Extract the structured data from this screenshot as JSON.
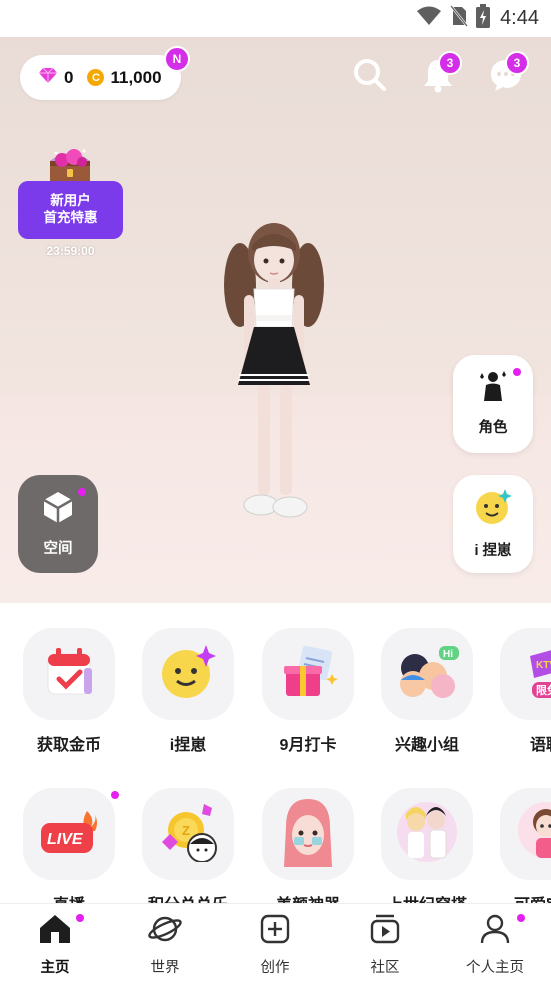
{
  "status_bar": {
    "time": "4:44",
    "icons": [
      "wifi-icon",
      "no-sim-icon",
      "battery-charging-icon"
    ]
  },
  "header": {
    "gems": "0",
    "coins": "11,000",
    "new_badge": "N",
    "notifications_count": "3",
    "messages_count": "3",
    "icons": [
      "gem-icon",
      "coin-icon",
      "search-icon",
      "bell-icon",
      "chat-icon"
    ]
  },
  "promo": {
    "line1": "新用户",
    "line2": "首充特惠",
    "timer": "23:59:00"
  },
  "side_actions": {
    "character_label": "角色",
    "face_edit_label": "i 捏崽",
    "space_label": "空间"
  },
  "feature_rows": [
    [
      {
        "label": "获取金币",
        "icon": "calendar-check-icon"
      },
      {
        "label": "i捏崽",
        "icon": "smile-face-icon"
      },
      {
        "label": "9月打卡",
        "icon": "gift-checklist-icon"
      },
      {
        "label": "兴趣小组",
        "icon": "group-hi-icon"
      },
      {
        "label": "语聊",
        "icon": "ktv-icon",
        "tag": "限免"
      }
    ],
    [
      {
        "label": "直播",
        "icon": "live-icon"
      },
      {
        "label": "积分总总乐",
        "icon": "points-coin-icon"
      },
      {
        "label": "美颜神器",
        "icon": "beauty-face-icon"
      },
      {
        "label": "上世纪穿搭",
        "icon": "retro-outfit-icon"
      },
      {
        "label": "可爱宝宝",
        "icon": "cute-baby-icon"
      }
    ]
  ],
  "bottom_nav": [
    {
      "label": "主页",
      "icon": "home-icon",
      "active": true
    },
    {
      "label": "世界",
      "icon": "planet-icon",
      "active": false
    },
    {
      "label": "创作",
      "icon": "plus-square-icon",
      "active": false
    },
    {
      "label": "社区",
      "icon": "play-square-icon",
      "active": false
    },
    {
      "label": "个人主页",
      "icon": "person-icon",
      "active": false
    }
  ],
  "colors": {
    "accent": "#d42ee8",
    "promo": "#7c3bea",
    "coin": "#f5a800",
    "hero_bg": "#efe2dc"
  }
}
